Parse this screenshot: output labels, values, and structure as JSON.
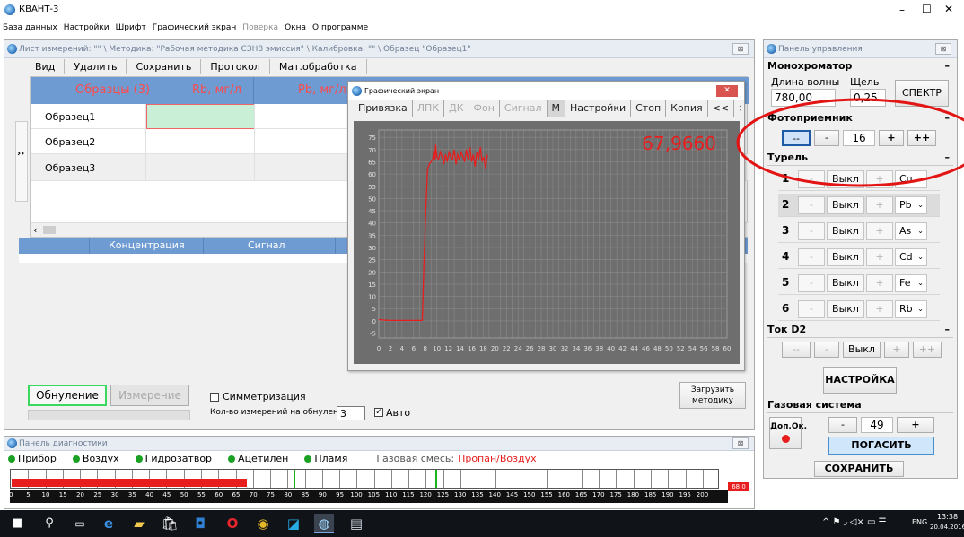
{
  "app": {
    "title": "КВАНТ-3",
    "min": "–",
    "max": "☐",
    "close": "✕"
  },
  "menu": [
    {
      "label": "База данных"
    },
    {
      "label": "Настройки"
    },
    {
      "label": "Шрифт"
    },
    {
      "label": "Графический экран"
    },
    {
      "label": "Поверка",
      "disabled": true
    },
    {
      "label": "Окна"
    },
    {
      "label": "О программе"
    }
  ],
  "sheet": {
    "title": "Лист измерений: \"\" \\ Методика: \"Рабочая методика СЗН8 эмиссия\" \\ Калибровка: \"\" \\ Образец \"Образец1\"",
    "close": "⊠",
    "toolbar": [
      "Вид",
      "Удалить",
      "Сохранить",
      "Протокол",
      "Мат.обработка"
    ],
    "columns": [
      "Образцы (3)",
      "Rb, мг/л",
      "Pb, мг/л"
    ],
    "rows": [
      "Образец1",
      "Образец2",
      "Образец3"
    ],
    "expander": "››",
    "scroll_left": "‹",
    "scroll_right": "›",
    "lower_columns": [
      "Концентрация",
      "Сигнал"
    ],
    "zero_btn": "Обнуление",
    "measure_btn": "Измерение",
    "symmetrization": "Симметризация",
    "count_label": "Кол-во измерений на обнуление:",
    "count_value": "3",
    "auto_label": "Авто",
    "load_method": "Загрузить методику"
  },
  "graph": {
    "title": "Графический экран",
    "tabs": [
      {
        "label": "Привязка",
        "disabled": false
      },
      {
        "label": "ЛПК",
        "disabled": true
      },
      {
        "label": "ДК",
        "disabled": true
      },
      {
        "label": "Фон",
        "disabled": true
      },
      {
        "label": "Сигнал",
        "disabled": true
      },
      {
        "label": "M",
        "disabled": false
      },
      {
        "label": "Настройки",
        "disabled": false
      },
      {
        "label": "Стоп",
        "disabled": false
      },
      {
        "label": "Копия",
        "disabled": false
      },
      {
        "label": "<<",
        "disabled": false
      },
      {
        "label": ">>",
        "disabled": false
      }
    ],
    "value": "67,9660",
    "line_color": "#e81e1e"
  },
  "chart_data": {
    "type": "line",
    "title": "",
    "xlabel": "",
    "ylabel": "",
    "xlim": [
      0,
      60
    ],
    "ylim": [
      -7,
      78
    ],
    "x_ticks": [
      0,
      2,
      4,
      6,
      8,
      10,
      12,
      14,
      16,
      18,
      20,
      22,
      24,
      26,
      28,
      30,
      32,
      34,
      36,
      38,
      40,
      42,
      44,
      46,
      48,
      50,
      52,
      54,
      56,
      58,
      60
    ],
    "y_ticks": [
      -5,
      0,
      5,
      10,
      15,
      20,
      25,
      30,
      35,
      40,
      45,
      50,
      55,
      60,
      65,
      70,
      75
    ],
    "grid": true,
    "series": [
      {
        "x": [
          0,
          1,
          2,
          3,
          4,
          5,
          6,
          7,
          7.5,
          7.8,
          8.1,
          8.4,
          8.7,
          9,
          9.3,
          9.5,
          9.7,
          9.8,
          10,
          10.3,
          10.6,
          10.9,
          11.2,
          11.5,
          11.8,
          12.1,
          12.4,
          12.7,
          13,
          13.3,
          13.6,
          13.9,
          14.2,
          14.5,
          14.8,
          15.1,
          15.4,
          15.7,
          16,
          16.3,
          16.6,
          16.9,
          17.2,
          17.5,
          17.8,
          18.1,
          18.4,
          18.7
        ],
        "y": [
          0.5,
          0.3,
          0.2,
          0.2,
          0.2,
          0.2,
          0.2,
          0.2,
          0.2,
          25,
          45,
          62,
          64,
          65,
          66,
          70,
          66,
          72,
          67,
          66,
          69,
          67,
          64,
          68,
          65,
          69,
          67,
          66,
          70,
          64,
          68,
          66,
          69,
          67,
          65,
          70,
          66,
          71,
          65,
          68,
          63,
          69,
          66,
          71,
          65,
          67,
          62,
          68
        ]
      }
    ]
  },
  "control": {
    "title": "Панель управления",
    "close": "⊠",
    "mono": {
      "title": "Монохроматор",
      "minimize": "–",
      "wl_label": "Длина волны",
      "slit_label": "Щель",
      "wl_value": "780,00",
      "slit_value": "0,25",
      "spectrum": "СПЕКТР"
    },
    "photo": {
      "title": "Фотоприемник",
      "minimize": "–",
      "b1": "--",
      "b2": "-",
      "value": "16",
      "b3": "+",
      "b4": "++"
    },
    "turret": {
      "title": "Турель",
      "minimize": "–",
      "rows": [
        {
          "num": "1",
          "minus": "-",
          "state": "Выкл",
          "plus": "+",
          "el": "Cu"
        },
        {
          "num": "2",
          "minus": "-",
          "state": "Выкл",
          "plus": "+",
          "el": "Pb"
        },
        {
          "num": "3",
          "minus": "-",
          "state": "Выкл",
          "plus": "+",
          "el": "As"
        },
        {
          "num": "4",
          "minus": "-",
          "state": "Выкл",
          "plus": "+",
          "el": "Cd"
        },
        {
          "num": "5",
          "minus": "-",
          "state": "Выкл",
          "plus": "+",
          "el": "Fe"
        },
        {
          "num": "6",
          "minus": "-",
          "state": "Выкл",
          "plus": "+",
          "el": "Rb"
        }
      ]
    },
    "d2": {
      "title": "Ток D2",
      "minimize": "–",
      "b1": "--",
      "b2": "-",
      "state": "Выкл",
      "b3": "+",
      "b4": "++"
    },
    "setup": "НАСТРОЙКА",
    "gas": {
      "title": "Газовая система",
      "extra": "Доп.Ок.",
      "minus": "-",
      "value": "49",
      "plus": "+",
      "off": "ПОГАСИТЬ"
    },
    "save": "СОХРАНИТЬ"
  },
  "diag": {
    "title": "Панель диагностики",
    "close": "⊠",
    "items": [
      "Прибор",
      "Воздух",
      "Гидрозатвор",
      "Ацетилен",
      "Пламя"
    ],
    "gas_label": "Газовая смесь:",
    "gas_value": "Пропан/Воздух",
    "bar_value": "68,0",
    "bar_fraction": 0.333,
    "bar_max": 200,
    "ticks": [
      0,
      5,
      10,
      15,
      20,
      25,
      30,
      35,
      40,
      45,
      50,
      55,
      60,
      65,
      70,
      75,
      80,
      85,
      90,
      95,
      100,
      105,
      110,
      115,
      120,
      125,
      130,
      135,
      140,
      145,
      150,
      155,
      160,
      165,
      170,
      175,
      180,
      185,
      190,
      195,
      200
    ]
  },
  "taskbar": {
    "lang": "ENG",
    "time": "13:38",
    "date": "20.04.2016",
    "tray": "^ ⚑ ◞ ◁× ▭ ☰"
  },
  "colors": {
    "accent": "#1f5aa6",
    "red": "#e81e1e",
    "grid_header": "#6f9bd3",
    "sample_selected": "#c9efd6"
  }
}
